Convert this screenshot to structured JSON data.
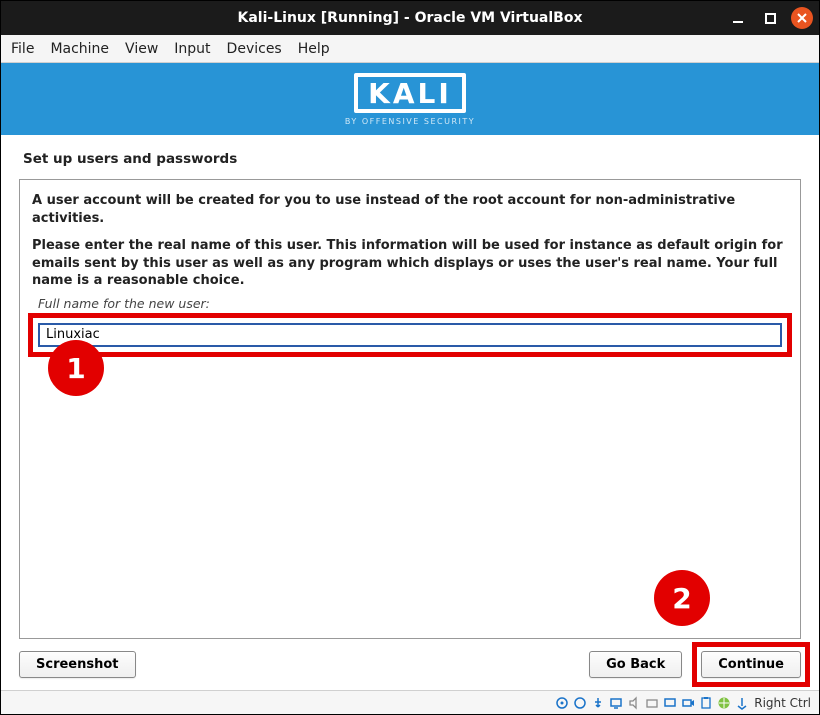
{
  "window": {
    "title": "Kali-Linux [Running] - Oracle VM VirtualBox"
  },
  "menubar": {
    "file": "File",
    "machine": "Machine",
    "view": "View",
    "input": "Input",
    "devices": "Devices",
    "help": "Help"
  },
  "banner": {
    "logo_text": "KALI",
    "logo_sub": "BY OFFENSIVE SECURITY"
  },
  "installer": {
    "step_title": "Set up users and passwords",
    "desc1": "A user account will be created for you to use instead of the root account for non-administrative activities.",
    "desc2": "Please enter the real name of this user. This information will be used for instance as default origin for emails sent by this user as well as any program which displays or uses the user's real name. Your full name is a reasonable choice.",
    "field_label": "Full name for the new user:",
    "field_value": "Linuxiac"
  },
  "buttons": {
    "screenshot": "Screenshot",
    "go_back": "Go Back",
    "continue": "Continue"
  },
  "annotations": {
    "marker1": "1",
    "marker2": "2"
  },
  "statusbar": {
    "host_key": "Right Ctrl"
  }
}
